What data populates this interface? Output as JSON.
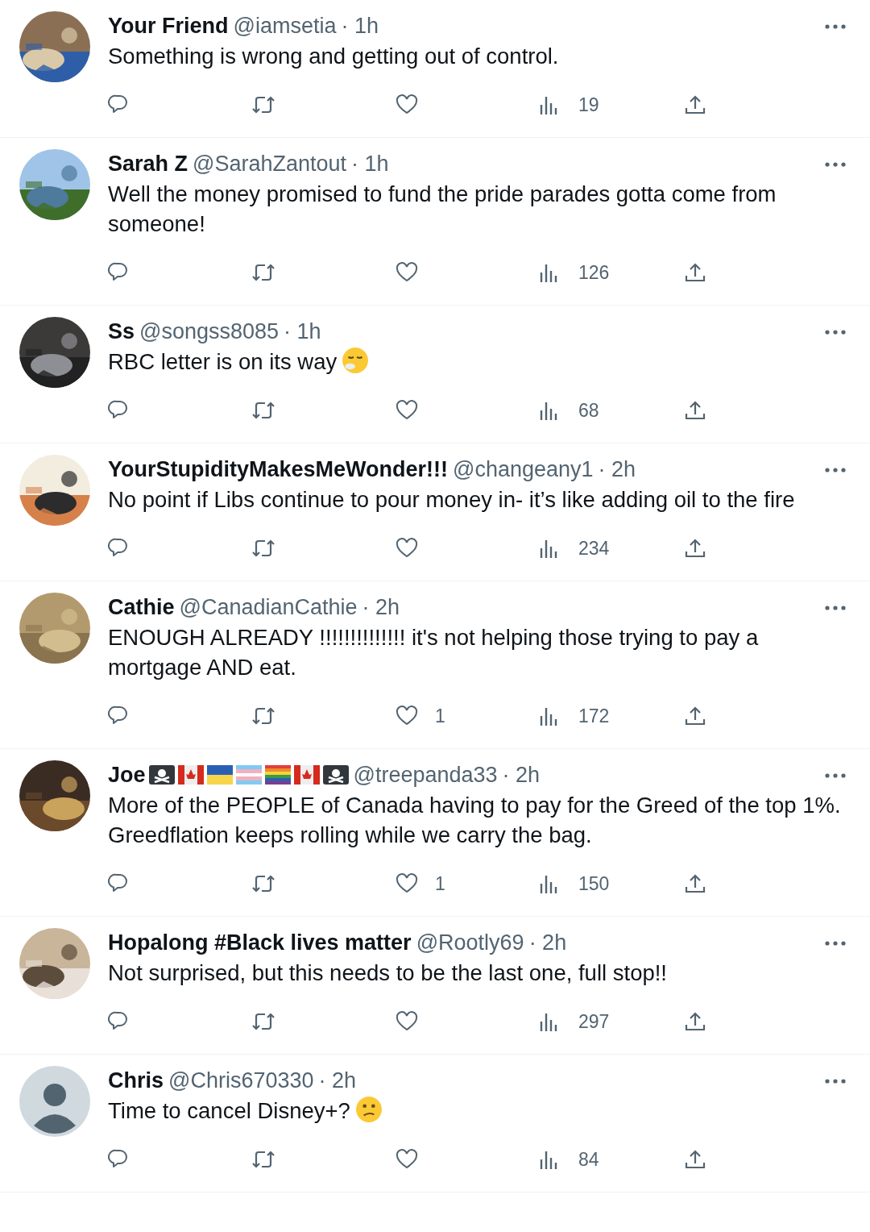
{
  "replies": [
    {
      "name": "Your Friend",
      "handle": "@iamsetia",
      "time": "· 1h",
      "text": "Something is wrong and getting out of control.",
      "avatar": {
        "kind": "picture"
      },
      "views": "19"
    },
    {
      "name": "Sarah Z",
      "handle": "@SarahZantout",
      "time": "· 1h",
      "text": "Well the money promised to fund the pride parades gotta come from someone!",
      "avatar": {
        "kind": "picture"
      },
      "views": "126"
    },
    {
      "name": "Ss",
      "handle": "@songss8085",
      "time": "· 1h",
      "text": "RBC letter is on its way",
      "emoji": {
        "kind": "sigh"
      },
      "avatar": {
        "kind": "picture"
      },
      "views": "68"
    },
    {
      "name": "YourStupidityMakesMeWonder!!!",
      "handle": "@changeany1",
      "time": "· 2h",
      "text": "No point if Libs continue to pour money in- it’s like adding oil to the fire",
      "avatar": {
        "kind": "picture"
      },
      "views": "234"
    },
    {
      "name": "Cathie",
      "handle": "@CanadianCathie",
      "time": "· 2h",
      "text": "ENOUGH ALREADY !!!!!!!!!!!!!! it's not helping those trying to pay a mortgage AND eat.",
      "avatar": {
        "kind": "picture"
      },
      "likes": "1",
      "views": "172"
    },
    {
      "name": "Joe",
      "badges": [
        {
          "kind": "skull"
        },
        {
          "kind": "canada"
        },
        {
          "kind": "ukraine"
        },
        {
          "kind": "trans"
        },
        {
          "kind": "rainbow"
        },
        {
          "kind": "canada"
        },
        {
          "kind": "skull"
        }
      ],
      "handle": "@treepanda33",
      "time": "· 2h",
      "text": "More of the PEOPLE of Canada having to pay for the Greed of the top 1%. Greedflation keeps rolling while we carry the bag.",
      "avatar": {
        "kind": "picture"
      },
      "likes": "1",
      "views": "150"
    },
    {
      "name": "Hopalong #Black lives matter",
      "handle": "@Rootly69",
      "time": "· 2h",
      "text": "Not surprised, but this needs to be the last one, full stop!!",
      "avatar": {
        "kind": "picture"
      },
      "views": "297"
    },
    {
      "name": "Chris",
      "handle": "@Chris670330",
      "time": "· 2h",
      "text": "Time to cancel Disney+?",
      "emoji": {
        "kind": "confused"
      },
      "avatar": {
        "kind": "default"
      },
      "views": "84"
    }
  ]
}
